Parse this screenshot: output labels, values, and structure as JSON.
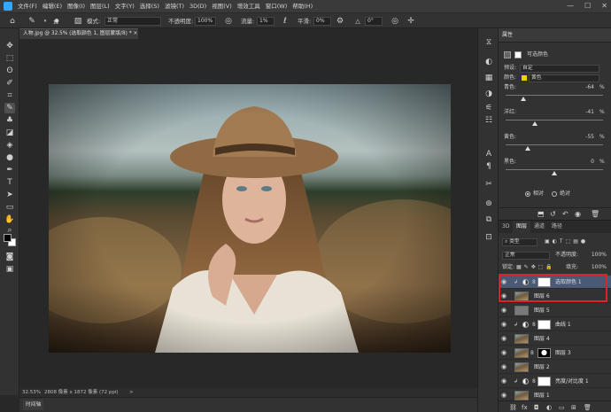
{
  "menu": [
    "文件(F)",
    "编辑(E)",
    "图像(I)",
    "图层(L)",
    "文字(Y)",
    "选择(S)",
    "滤镜(T)",
    "3D(D)",
    "视图(V)",
    "增效工具",
    "窗口(W)",
    "帮助(H)"
  ],
  "window_controls": [
    "—",
    "☐",
    "✕"
  ],
  "options_bar": {
    "brush_size": "12",
    "mode_label": "模式:",
    "mode_value": "正常",
    "opacity_label": "不透明度:",
    "opacity_value": "100%",
    "flow_label": "流量:",
    "flow_value": "1%",
    "smooth_label": "平滑:",
    "smooth_value": "0%",
    "angle_value": "0°"
  },
  "document_tab": "人物.jpg @ 32.5% (选取颜色 1, 图层蒙版/8) * ×",
  "status": {
    "zoom": "32.53%",
    "size": "2808 像素 x 1872 像素 (72 ppi)",
    "arrow": ">"
  },
  "timeline_tab": "时间轴",
  "properties": {
    "title": "属性",
    "adjustment_name": "可选颜色",
    "preset_label": "预设:",
    "preset_value": "自定",
    "colors_label": "颜色:",
    "colors_value": "黄色",
    "swatch_color": "#f5d000",
    "sliders": [
      {
        "label": "青色:",
        "value": "-64",
        "unit": "%",
        "fraction": 0.18
      },
      {
        "label": "洋红:",
        "value": "-41",
        "unit": "%",
        "fraction": 0.3
      },
      {
        "label": "黄色:",
        "value": "-55",
        "unit": "%",
        "fraction": 0.23
      },
      {
        "label": "黑色:",
        "value": "0",
        "unit": "%",
        "fraction": 0.5
      }
    ],
    "method_relative": "相对",
    "method_absolute": "绝对"
  },
  "layers_panel": {
    "tabs": [
      "3D",
      "图层",
      "通道",
      "路径"
    ],
    "active_tab": "图层",
    "filter_label": "类型",
    "blend_mode": "正常",
    "opacity_label": "不透明度:",
    "opacity_value": "100%",
    "lock_label": "锁定:",
    "fill_label": "填充:",
    "fill_value": "100%",
    "layers": [
      {
        "name": "选取颜色 1",
        "kind": "adjust",
        "clipped": true,
        "selected": true
      },
      {
        "name": "图层 6",
        "kind": "image",
        "clipped": false,
        "selected": false
      },
      {
        "name": "图层 5",
        "kind": "gray",
        "clipped": false,
        "selected": false
      },
      {
        "name": "曲线 1",
        "kind": "adjust",
        "clipped": true,
        "selected": false
      },
      {
        "name": "图层 4",
        "kind": "image",
        "clipped": true,
        "selected": false
      },
      {
        "name": "图层 3",
        "kind": "image-mask",
        "clipped": false,
        "selected": false
      },
      {
        "name": "图层 2",
        "kind": "image",
        "clipped": false,
        "selected": false
      },
      {
        "name": "亮度/对比度 1",
        "kind": "adjust",
        "clipped": true,
        "selected": false
      },
      {
        "name": "图层 1",
        "kind": "image",
        "clipped": false,
        "selected": false
      }
    ]
  },
  "colors": {
    "accent": "#31a8ff",
    "selection": "#4a5a74",
    "highlight": "#e0202a"
  }
}
